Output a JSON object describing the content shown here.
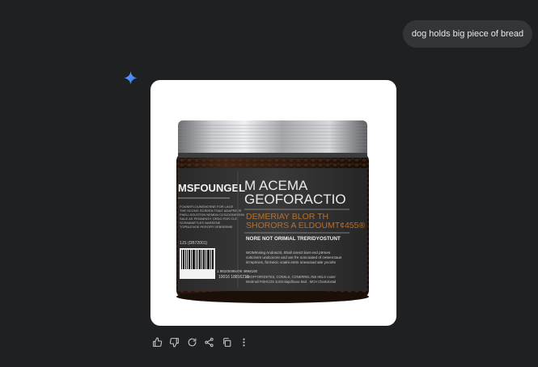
{
  "conversation": {
    "user_message": "dog holds big piece of bread"
  },
  "generated_image": {
    "label_left_title": "MSFOUNGEL",
    "label_left_small_lines": [
      "FOUNEFLOUNEMOSNE FOR LAGE",
      "THE SCONG SCREEN TSAIT ADAPREVE",
      "FNELLSOUSTON NEMDN CLSLDONEMON",
      "SALE AS PENNENSY ORDO FOR CLE",
      "SCRMANETLES NAREENE",
      "TOPBLENOE PEROFR VEBSERME"
    ],
    "label_code_small": "1JS (DB72001)",
    "barcode_number_1": "1 98100496400 4894100",
    "barcode_number_2": "10016 18816210",
    "product_name_line1": "M ACEMA",
    "product_name_line2": "GEOFORACTIO",
    "accent_line1": "DEMERIAY BLOR TH",
    "accent_line2": "SHORORS A ELDOUMT¢455®",
    "subheading": "NORE NOT ORIMIAL TRERIDYOSTUNT",
    "body_line1": "WOMInsing Andosctit, Shall oneict lioet end ptrmes",
    "body_line2": "coticinsm undcocore and are fre ooncoated of ceteerctaus",
    "body_line3": "is'reprions, formecic voalni entm oneacsad aite yocolts",
    "foot_line1": "NEOFFORONITES, CONSLS, CONERREL INS HELS rooter",
    "foot_line2": "Medrnall FISHCOS 3orOrolapdfouse 8sul . MCH Chartolostal"
  },
  "actions": {
    "items": [
      "thumbs-up",
      "thumbs-down",
      "regenerate",
      "share",
      "copy",
      "more-options"
    ]
  },
  "colors": {
    "background": "#1f2022",
    "bubble": "#333537",
    "sparkle": "#4a90f0",
    "accent_text": "#b8702a"
  }
}
